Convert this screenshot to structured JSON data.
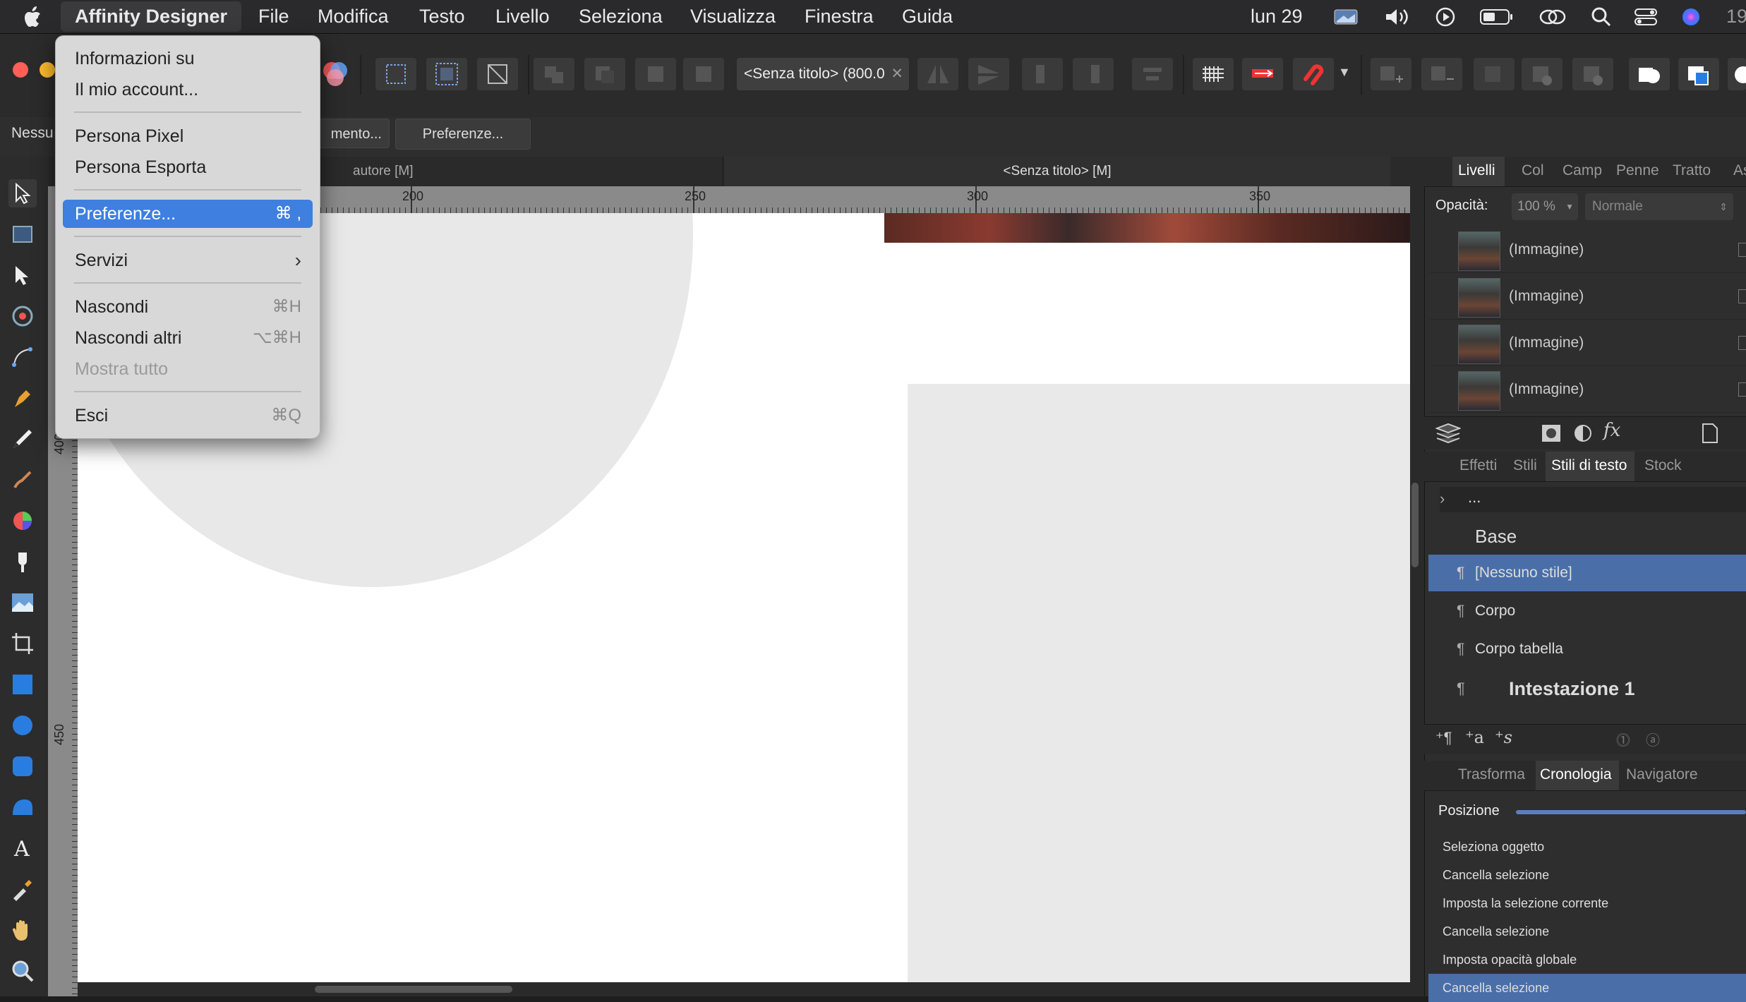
{
  "menubar": {
    "app_name": "Affinity Designer",
    "items": [
      "File",
      "Modifica",
      "Testo",
      "Livello",
      "Seleziona",
      "Visualizza",
      "Finestra",
      "Guida"
    ],
    "date": "lun 29",
    "clock_partial": "19"
  },
  "app_menu": {
    "about": "Informazioni su",
    "account": "Il mio account...",
    "persona_pixel": "Persona Pixel",
    "persona_export": "Persona Esporta",
    "preferences": "Preferenze...",
    "preferences_shortcut": "⌘ ,",
    "services": "Servizi",
    "hide": "Nascondi",
    "hide_shortcut": "⌘H",
    "hide_others": "Nascondi altri",
    "hide_others_shortcut": "⌥⌘H",
    "show_all": "Mostra tutto",
    "quit": "Esci",
    "quit_shortcut": "⌘Q"
  },
  "toolbar": {
    "doc_selector": "<Senza titolo> (800.0",
    "context_left": "Nessu",
    "context_btn1": "mento...",
    "context_btn2": "Preferenze..."
  },
  "doc_tabs": [
    "autore [M]",
    "<Senza titolo> [M]"
  ],
  "rulers": {
    "h_ticks": [
      "200",
      "250",
      "300",
      "350"
    ],
    "v_ticks": [
      "400",
      "450"
    ]
  },
  "layers_panel": {
    "tabs": [
      "Livelli",
      "Col",
      "Camp",
      "Penne",
      "Tratto",
      "As"
    ],
    "opacity_label": "Opacità:",
    "opacity_value": "100 %",
    "blend_mode": "Normale",
    "layers": [
      "(Immagine)",
      "(Immagine)",
      "(Immagine)",
      "(Immagine)"
    ]
  },
  "styles_panel": {
    "tabs": [
      "Effetti",
      "Stili",
      "Stili di testo",
      "Stock"
    ],
    "path": "...",
    "group": "Base",
    "styles": [
      "[Nessuno stile]",
      "Corpo",
      "Corpo tabella",
      "Intestazione 1"
    ]
  },
  "history_panel": {
    "tabs": [
      "Trasforma",
      "Cronologia",
      "Navigatore"
    ],
    "position_label": "Posizione",
    "entries": [
      "Seleziona oggetto",
      "Cancella selezione",
      "Imposta la selezione corrente",
      "Cancella selezione",
      "Imposta opacità globale",
      "Cancella selezione"
    ]
  },
  "colors": {
    "accent": "#3e7fe0",
    "menubar_bg": "#2a2a2c",
    "panel_bg": "#2e2e2e",
    "selected_row": "#4a6ea8"
  }
}
